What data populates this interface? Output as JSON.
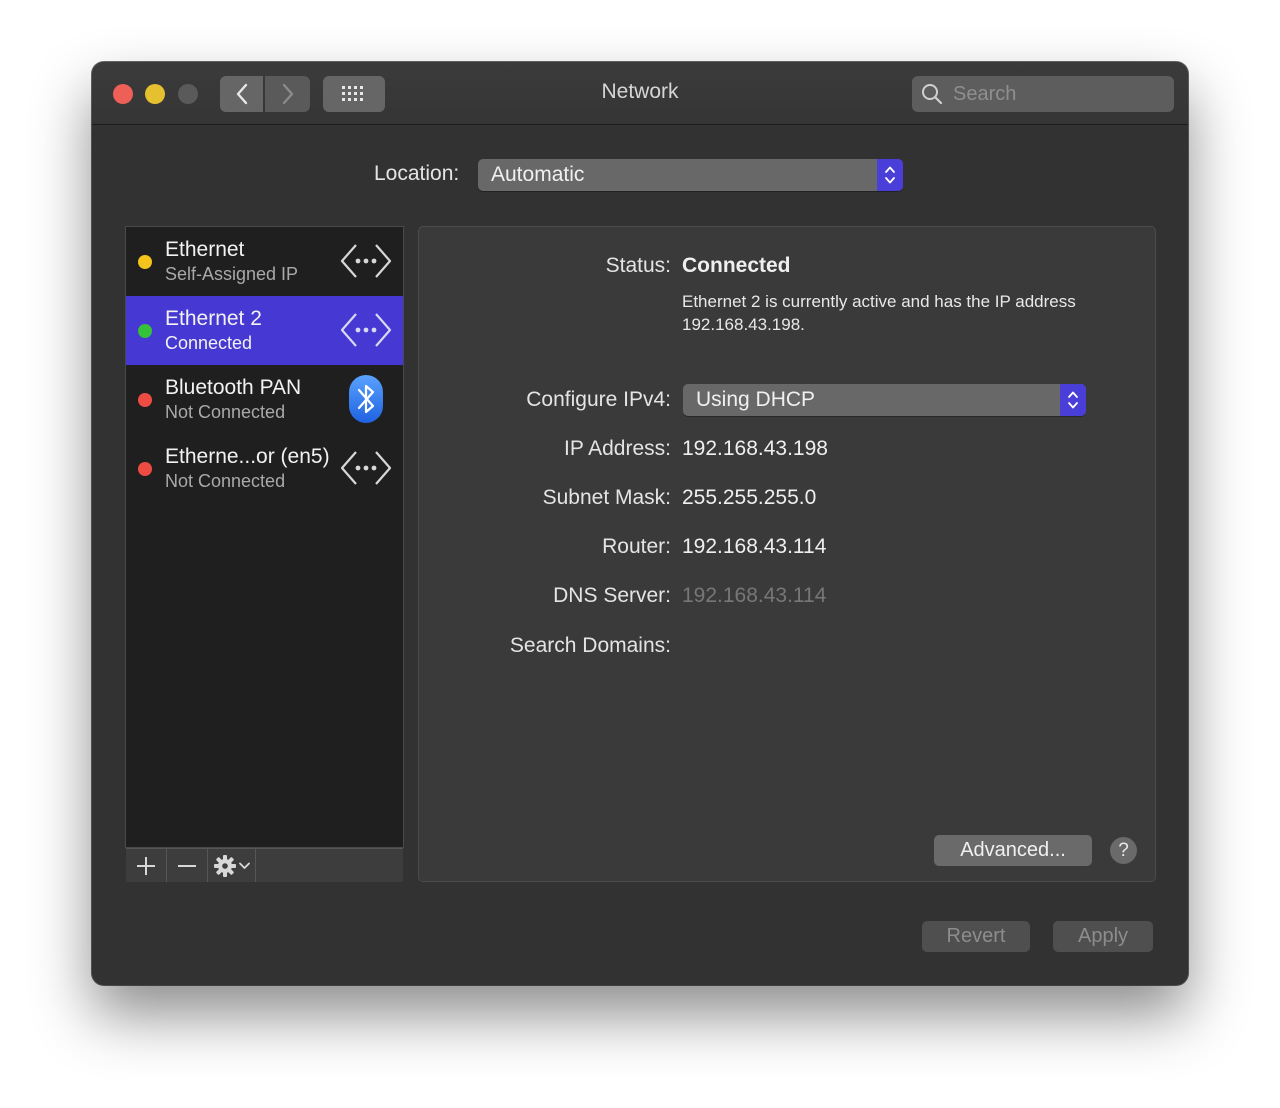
{
  "window": {
    "title": "Network",
    "search": {
      "placeholder": "Search",
      "value": ""
    }
  },
  "location": {
    "label": "Location:",
    "value": "Automatic"
  },
  "services": [
    {
      "name": "Ethernet",
      "status": "Self-Assigned IP",
      "dot_color": "#f4c41c",
      "icon": "ethernet-icon",
      "selected": false
    },
    {
      "name": "Ethernet 2",
      "status": "Connected",
      "dot_color": "#35c23a",
      "icon": "ethernet-icon",
      "selected": true
    },
    {
      "name": "Bluetooth PAN",
      "status": "Not Connected",
      "dot_color": "#ee4c43",
      "icon": "bluetooth-icon",
      "selected": false
    },
    {
      "name": "Etherne...or (en5)",
      "status": "Not Connected",
      "dot_color": "#ee4c43",
      "icon": "ethernet-icon",
      "selected": false
    }
  ],
  "detail": {
    "status_label": "Status:",
    "status_value": "Connected",
    "status_description": "Ethernet 2 is currently active and has the IP address 192.168.43.198.",
    "configure_label": "Configure IPv4:",
    "configure_value": "Using DHCP",
    "ip_label": "IP Address:",
    "ip_value": "192.168.43.198",
    "subnet_label": "Subnet Mask:",
    "subnet_value": "255.255.255.0",
    "router_label": "Router:",
    "router_value": "192.168.43.114",
    "dns_label": "DNS Server:",
    "dns_value": "192.168.43.114",
    "search_domains_label": "Search Domains:",
    "advanced_label": "Advanced...",
    "help_label": "?"
  },
  "footer": {
    "revert_label": "Revert",
    "apply_label": "Apply"
  },
  "colors": {
    "accent": "#4638d2",
    "window_bg": "#323232"
  }
}
